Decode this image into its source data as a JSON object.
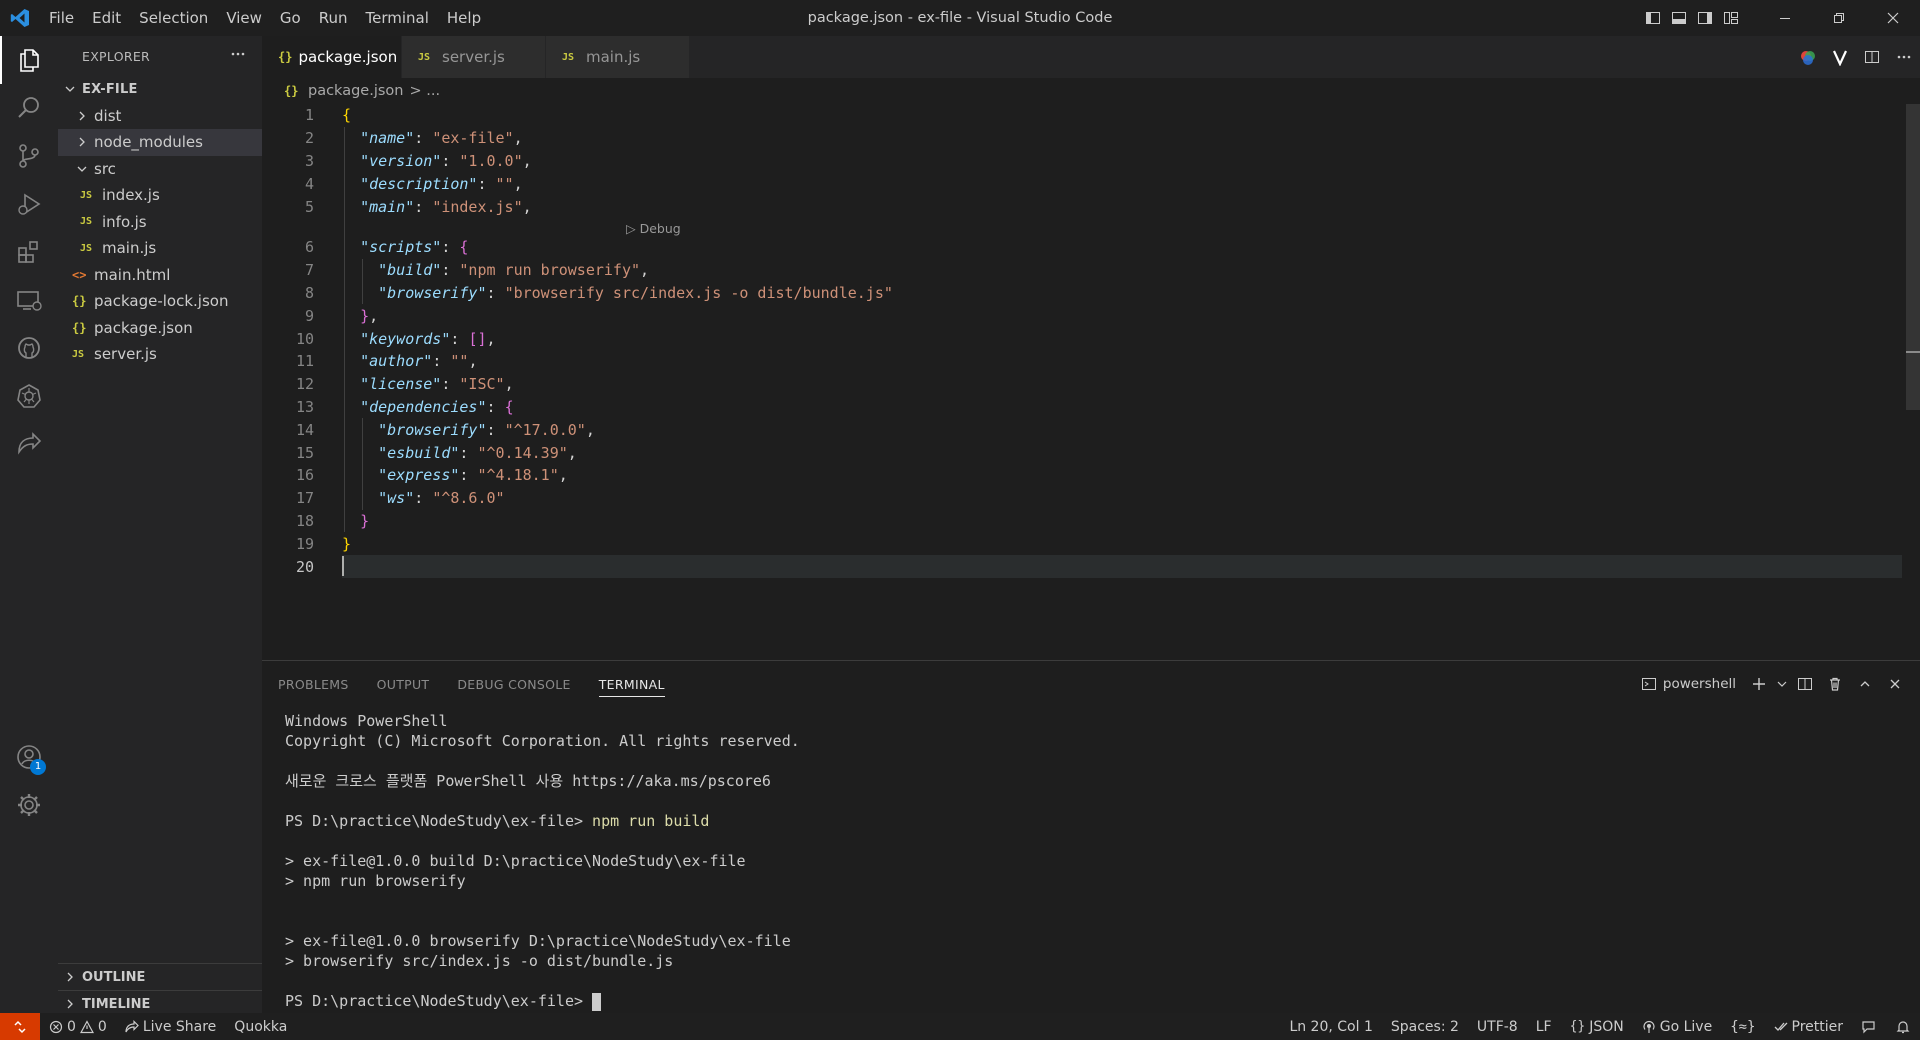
{
  "window": {
    "title": "package.json - ex-file - Visual Studio Code",
    "menu": [
      "File",
      "Edit",
      "Selection",
      "View",
      "Go",
      "Run",
      "Terminal",
      "Help"
    ]
  },
  "sidebar": {
    "header": "EXPLORER",
    "root": "EX-FILE",
    "items": [
      {
        "label": "dist",
        "type": "folder",
        "expanded": false,
        "depth": 1
      },
      {
        "label": "node_modules",
        "type": "folder",
        "expanded": false,
        "depth": 1,
        "selected": true
      },
      {
        "label": "src",
        "type": "folder",
        "expanded": true,
        "depth": 1
      },
      {
        "label": "index.js",
        "type": "js",
        "depth": 2
      },
      {
        "label": "info.js",
        "type": "js",
        "depth": 2
      },
      {
        "label": "main.js",
        "type": "js",
        "depth": 2
      },
      {
        "label": "main.html",
        "type": "html",
        "depth": 1
      },
      {
        "label": "package-lock.json",
        "type": "json",
        "depth": 1
      },
      {
        "label": "package.json",
        "type": "json",
        "depth": 1
      },
      {
        "label": "server.js",
        "type": "js",
        "depth": 1
      }
    ],
    "outline": "OUTLINE",
    "timeline": "TIMELINE"
  },
  "icons": {
    "js": "JS",
    "json": "{}",
    "html": "<>"
  },
  "tabs": [
    {
      "label": "package.json",
      "type": "json",
      "active": true
    },
    {
      "label": "server.js",
      "type": "js",
      "active": false
    },
    {
      "label": "main.js",
      "type": "js",
      "active": false
    }
  ],
  "breadcrumb": {
    "file": "package.json",
    "rest": "> ..."
  },
  "editor": {
    "codelens": "▷ Debug",
    "lines": [
      [
        {
          "t": "{",
          "c": "b1"
        }
      ],
      [
        {
          "t": "  ",
          "c": "p"
        },
        {
          "t": "\"name\"",
          "c": "k"
        },
        {
          "t": ": ",
          "c": "p"
        },
        {
          "t": "\"ex-file\"",
          "c": "s"
        },
        {
          "t": ",",
          "c": "p"
        }
      ],
      [
        {
          "t": "  ",
          "c": "p"
        },
        {
          "t": "\"version\"",
          "c": "k"
        },
        {
          "t": ": ",
          "c": "p"
        },
        {
          "t": "\"1.0.0\"",
          "c": "s"
        },
        {
          "t": ",",
          "c": "p"
        }
      ],
      [
        {
          "t": "  ",
          "c": "p"
        },
        {
          "t": "\"description\"",
          "c": "k"
        },
        {
          "t": ": ",
          "c": "p"
        },
        {
          "t": "\"\"",
          "c": "s"
        },
        {
          "t": ",",
          "c": "p"
        }
      ],
      [
        {
          "t": "  ",
          "c": "p"
        },
        {
          "t": "\"main\"",
          "c": "k"
        },
        {
          "t": ": ",
          "c": "p"
        },
        {
          "t": "\"index.js\"",
          "c": "s"
        },
        {
          "t": ",",
          "c": "p"
        }
      ],
      [
        {
          "t": "  ",
          "c": "p"
        },
        {
          "t": "\"scripts\"",
          "c": "k"
        },
        {
          "t": ": ",
          "c": "p"
        },
        {
          "t": "{",
          "c": "b2"
        }
      ],
      [
        {
          "t": "    ",
          "c": "p"
        },
        {
          "t": "\"build\"",
          "c": "k"
        },
        {
          "t": ": ",
          "c": "p"
        },
        {
          "t": "\"npm run browserify\"",
          "c": "s"
        },
        {
          "t": ",",
          "c": "p"
        }
      ],
      [
        {
          "t": "    ",
          "c": "p"
        },
        {
          "t": "\"browserify\"",
          "c": "k"
        },
        {
          "t": ": ",
          "c": "p"
        },
        {
          "t": "\"browserify src/index.js -o dist/bundle.js\"",
          "c": "s"
        }
      ],
      [
        {
          "t": "  ",
          "c": "p"
        },
        {
          "t": "}",
          "c": "b2"
        },
        {
          "t": ",",
          "c": "p"
        }
      ],
      [
        {
          "t": "  ",
          "c": "p"
        },
        {
          "t": "\"keywords\"",
          "c": "k"
        },
        {
          "t": ": ",
          "c": "p"
        },
        {
          "t": "[]",
          "c": "b2"
        },
        {
          "t": ",",
          "c": "p"
        }
      ],
      [
        {
          "t": "  ",
          "c": "p"
        },
        {
          "t": "\"author\"",
          "c": "k"
        },
        {
          "t": ": ",
          "c": "p"
        },
        {
          "t": "\"\"",
          "c": "s"
        },
        {
          "t": ",",
          "c": "p"
        }
      ],
      [
        {
          "t": "  ",
          "c": "p"
        },
        {
          "t": "\"license\"",
          "c": "k"
        },
        {
          "t": ": ",
          "c": "p"
        },
        {
          "t": "\"ISC\"",
          "c": "s"
        },
        {
          "t": ",",
          "c": "p"
        }
      ],
      [
        {
          "t": "  ",
          "c": "p"
        },
        {
          "t": "\"dependencies\"",
          "c": "k"
        },
        {
          "t": ": ",
          "c": "p"
        },
        {
          "t": "{",
          "c": "b2"
        }
      ],
      [
        {
          "t": "    ",
          "c": "p"
        },
        {
          "t": "\"browserify\"",
          "c": "k"
        },
        {
          "t": ": ",
          "c": "p"
        },
        {
          "t": "\"^17.0.0\"",
          "c": "s"
        },
        {
          "t": ",",
          "c": "p"
        }
      ],
      [
        {
          "t": "    ",
          "c": "p"
        },
        {
          "t": "\"esbuild\"",
          "c": "k"
        },
        {
          "t": ": ",
          "c": "p"
        },
        {
          "t": "\"^0.14.39\"",
          "c": "s"
        },
        {
          "t": ",",
          "c": "p"
        }
      ],
      [
        {
          "t": "    ",
          "c": "p"
        },
        {
          "t": "\"express\"",
          "c": "k"
        },
        {
          "t": ": ",
          "c": "p"
        },
        {
          "t": "\"^4.18.1\"",
          "c": "s"
        },
        {
          "t": ",",
          "c": "p"
        }
      ],
      [
        {
          "t": "    ",
          "c": "p"
        },
        {
          "t": "\"ws\"",
          "c": "k"
        },
        {
          "t": ": ",
          "c": "p"
        },
        {
          "t": "\"^8.6.0\"",
          "c": "s"
        }
      ],
      [
        {
          "t": "  ",
          "c": "p"
        },
        {
          "t": "}",
          "c": "b2"
        }
      ],
      [
        {
          "t": "}",
          "c": "b1"
        }
      ],
      []
    ],
    "line_numbers": [
      "1",
      "2",
      "3",
      "4",
      "5",
      "6",
      "7",
      "8",
      "9",
      "10",
      "11",
      "12",
      "13",
      "14",
      "15",
      "16",
      "17",
      "18",
      "19",
      "20"
    ],
    "current_line": 20
  },
  "panel": {
    "tabs": [
      "PROBLEMS",
      "OUTPUT",
      "DEBUG CONSOLE",
      "TERMINAL"
    ],
    "active_tab": "TERMINAL",
    "terminal_name": "powershell",
    "terminal": [
      {
        "t": "Windows PowerShell"
      },
      {
        "t": "Copyright (C) Microsoft Corporation. All rights reserved."
      },
      {
        "gap": true
      },
      {
        "t": "새로운 크로스 플랫폼 PowerShell 사용 https://aka.ms/pscore6"
      },
      {
        "gap": true
      },
      {
        "prompt": "PS D:\\practice\\NodeStudy\\ex-file> ",
        "cmd": "npm run build"
      },
      {
        "gap": true
      },
      {
        "t": "> ex-file@1.0.0 build D:\\practice\\NodeStudy\\ex-file"
      },
      {
        "t": "> npm run browserify"
      },
      {
        "gap": true
      },
      {
        "gap": true
      },
      {
        "t": "> ex-file@1.0.0 browserify D:\\practice\\NodeStudy\\ex-file"
      },
      {
        "t": "> browserify src/index.js -o dist/bundle.js"
      },
      {
        "gap": true
      },
      {
        "prompt": "PS D:\\practice\\NodeStudy\\ex-file> ",
        "cmd": "",
        "caret": true
      }
    ]
  },
  "statusbar": {
    "errors": "0",
    "warnings": "0",
    "live_share": "Live Share",
    "quokka": "Quokka",
    "position": "Ln 20, Col 1",
    "spaces": "Spaces: 2",
    "encoding": "UTF-8",
    "eol": "LF",
    "language": "JSON",
    "go_live": "Go Live",
    "prettier": "Prettier"
  },
  "accounts_badge": "1",
  "colors": {
    "accent": "#0078d4",
    "remote": "#d73a00",
    "key": "#9cdcfe",
    "string": "#ce9178",
    "bracket1": "#ffd700",
    "bracket2": "#da70d6"
  }
}
